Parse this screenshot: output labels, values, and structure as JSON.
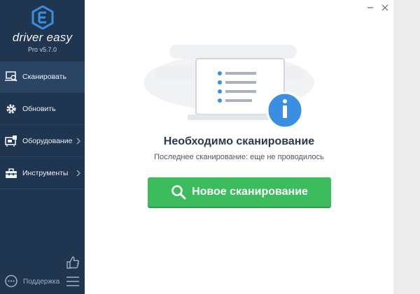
{
  "app": {
    "brand": "driver easy",
    "version": "Pro v5.7.0"
  },
  "sidebar": {
    "items": [
      {
        "label": "Сканировать",
        "icon": "scan-laptop-icon",
        "active": true
      },
      {
        "label": "Обновить",
        "icon": "gear-icon",
        "active": false
      },
      {
        "label": "Оборудование",
        "icon": "hardware-icon",
        "active": false
      },
      {
        "label": "Инструменты",
        "icon": "toolbox-icon",
        "active": false
      }
    ],
    "support_label": "Поддержка"
  },
  "main": {
    "headline": "Необходимо сканирование",
    "subline": "Последнее сканирование: еще не проводилось",
    "scan_button_label": "Новое сканирование"
  },
  "colors": {
    "sidebar_bg": "#1f3550",
    "sidebar_active": "#2a4563",
    "accent_green": "#3cbc5d",
    "info_blue": "#3b8fe0"
  }
}
